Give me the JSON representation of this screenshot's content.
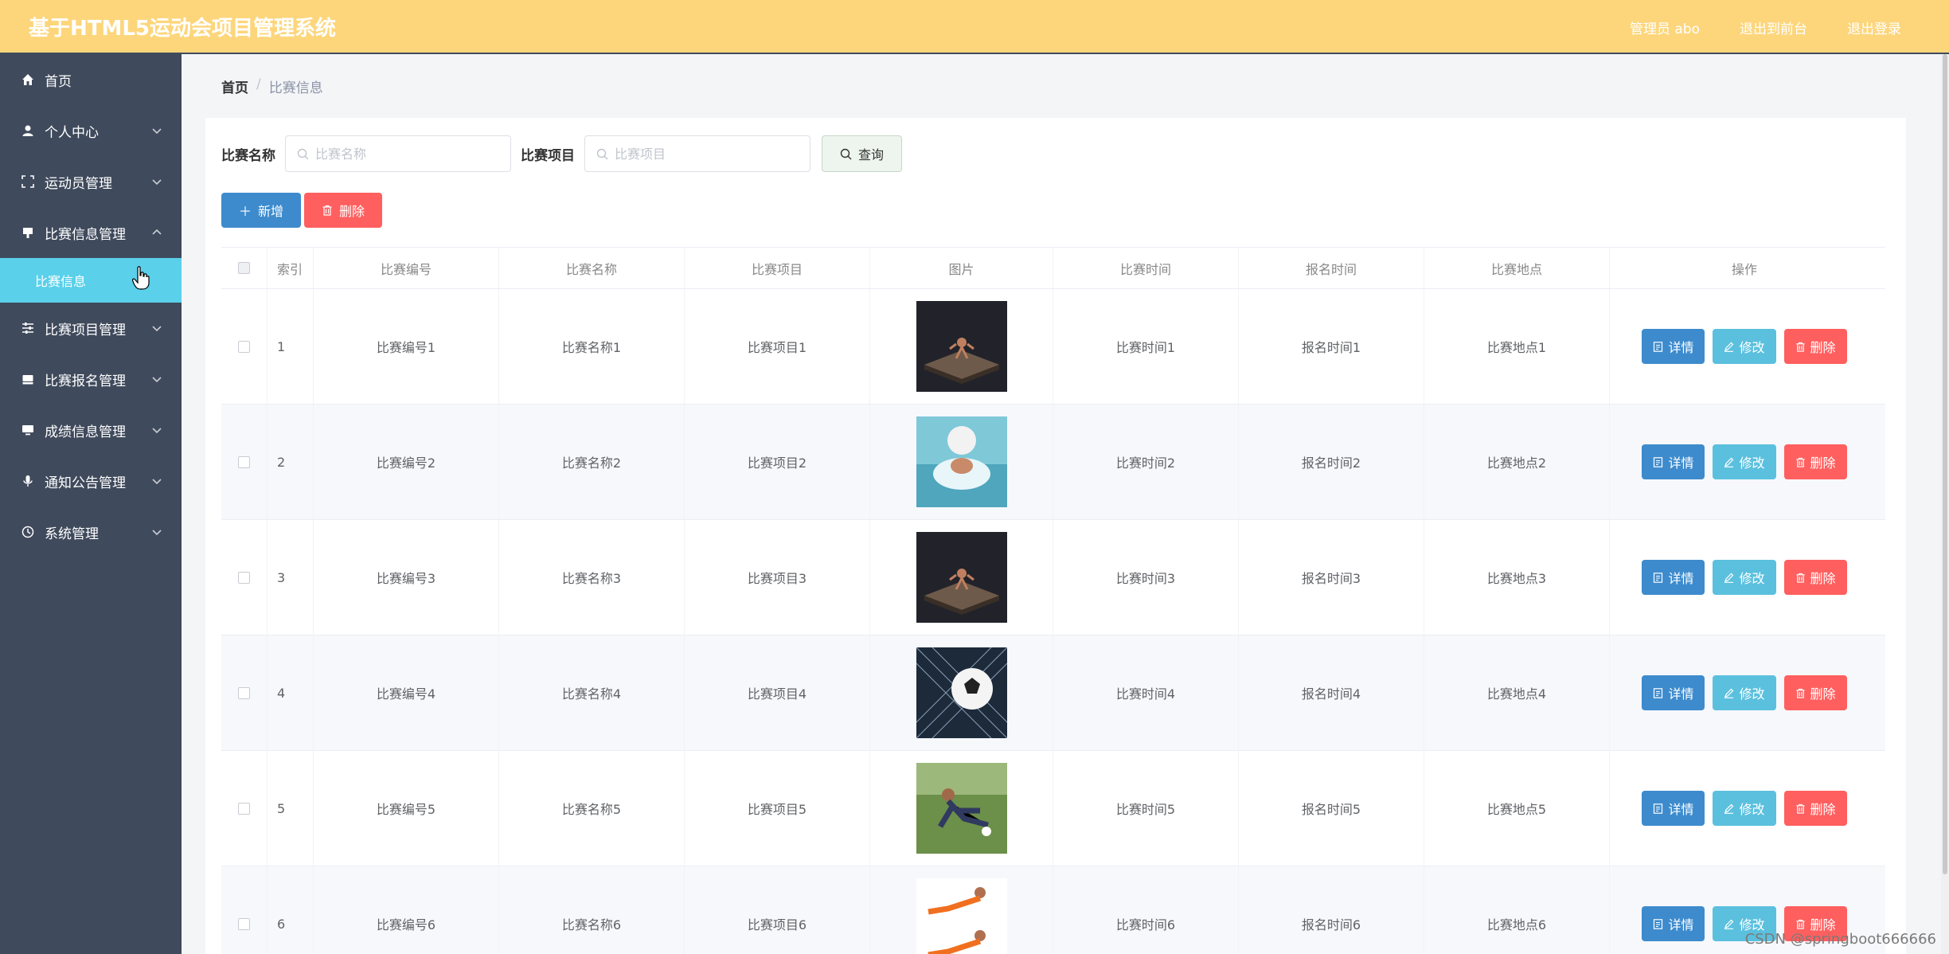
{
  "header": {
    "title": "基于HTML5运动会项目管理系统",
    "user_label": "管理员 abo",
    "back_front": "退出到前台",
    "logout": "退出登录"
  },
  "sidebar": {
    "items": [
      {
        "label": "首页",
        "icon": "home-icon"
      },
      {
        "label": "个人中心",
        "icon": "user-icon"
      },
      {
        "label": "运动员管理",
        "icon": "fullscreen-icon"
      },
      {
        "label": "比赛信息管理",
        "icon": "flag-icon"
      },
      {
        "label": "比赛项目管理",
        "icon": "sliders-icon"
      },
      {
        "label": "比赛报名管理",
        "icon": "tray-icon"
      },
      {
        "label": "成绩信息管理",
        "icon": "monitor-icon"
      },
      {
        "label": "通知公告管理",
        "icon": "mic-icon"
      },
      {
        "label": "系统管理",
        "icon": "clock-icon"
      }
    ],
    "active_sub": "比赛信息"
  },
  "breadcrumb": {
    "home": "首页",
    "sep": "/",
    "current": "比赛信息"
  },
  "search": {
    "name_label": "比赛名称",
    "name_placeholder": "比赛名称",
    "project_label": "比赛项目",
    "project_placeholder": "比赛项目",
    "query_button": "查询"
  },
  "actions": {
    "add": "新增",
    "delete": "删除"
  },
  "table": {
    "headers": [
      "索引",
      "比赛编号",
      "比赛名称",
      "比赛项目",
      "图片",
      "比赛时间",
      "报名时间",
      "比赛地点",
      "操作"
    ],
    "ops": {
      "detail": "详情",
      "edit": "修改",
      "delete": "删除"
    },
    "rows": [
      {
        "idx": "1",
        "code": "比赛编号1",
        "name": "比赛名称1",
        "project": "比赛项目1",
        "time": "比赛时间1",
        "signup": "报名时间1",
        "place": "比赛地点1"
      },
      {
        "idx": "2",
        "code": "比赛编号2",
        "name": "比赛名称2",
        "project": "比赛项目2",
        "time": "比赛时间2",
        "signup": "报名时间2",
        "place": "比赛地点2"
      },
      {
        "idx": "3",
        "code": "比赛编号3",
        "name": "比赛名称3",
        "project": "比赛项目3",
        "time": "比赛时间3",
        "signup": "报名时间3",
        "place": "比赛地点3"
      },
      {
        "idx": "4",
        "code": "比赛编号4",
        "name": "比赛名称4",
        "project": "比赛项目4",
        "time": "比赛时间4",
        "signup": "报名时间4",
        "place": "比赛地点4"
      },
      {
        "idx": "5",
        "code": "比赛编号5",
        "name": "比赛名称5",
        "project": "比赛项目5",
        "time": "比赛时间5",
        "signup": "报名时间5",
        "place": "比赛地点5"
      },
      {
        "idx": "6",
        "code": "比赛编号6",
        "name": "比赛名称6",
        "project": "比赛项目6",
        "time": "比赛时间6",
        "signup": "报名时间6",
        "place": "比赛地点6"
      }
    ]
  },
  "watermark": "CSDN @springboot666666",
  "colors": {
    "header_bg": "#fdd67c",
    "sidebar_bg": "#3f4a5c",
    "active_sub_bg": "#5ad0ea",
    "primary": "#3d8bcd",
    "info": "#5bc0de",
    "danger": "#ff5f5f"
  }
}
